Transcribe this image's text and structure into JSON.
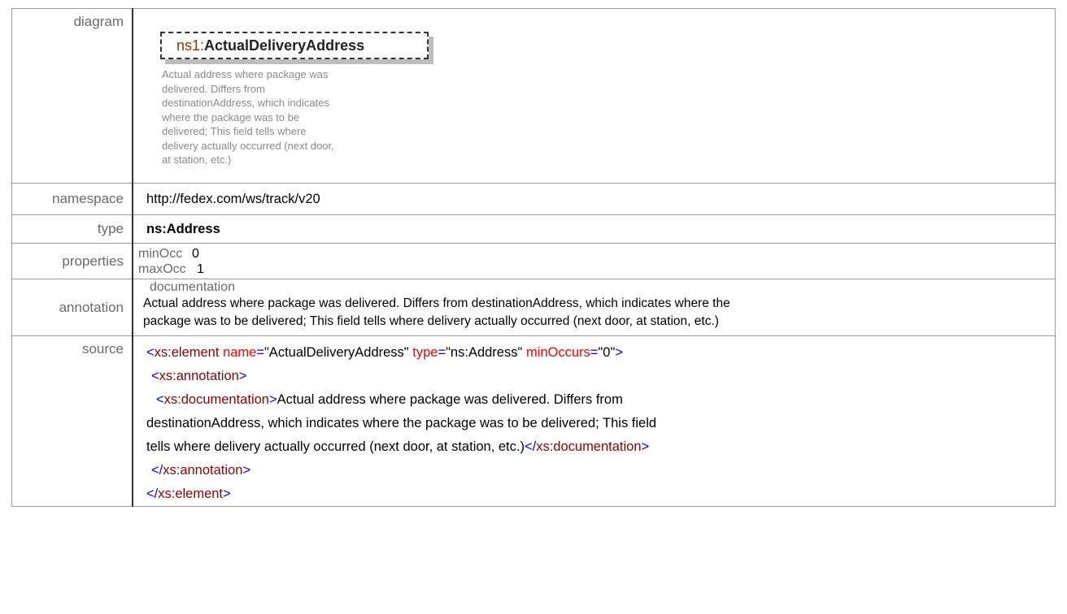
{
  "labels": {
    "diagram": "diagram",
    "namespace": "namespace",
    "type": "type",
    "properties": "properties",
    "annotation": "annotation",
    "source": "source"
  },
  "diagram": {
    "prefix": "ns1:",
    "name": "ActualDeliveryAddress",
    "doc_lines": [
      "Actual address where package was",
      "delivered. Differs from",
      "destinationAddress, which indicates",
      "where the package was to be",
      "delivered; This field tells where",
      "delivery actually occurred (next door,",
      "at station, etc.)"
    ]
  },
  "namespace": "http://fedex.com/ws/track/v20",
  "type": "ns:Address",
  "properties": {
    "min_label": "minOcc",
    "min_value": "0",
    "max_label": "maxOcc",
    "max_value": "1"
  },
  "annotation": {
    "heading": "documentation",
    "line1": "Actual address where package was delivered. Differs from destinationAddress, which indicates where the",
    "line2": "package was to be delivered; This field tells where delivery actually occurred (next door, at station, etc.)"
  },
  "source": {
    "lt": "<",
    "gt": ">",
    "lt_slash": "</",
    "eq": "=",
    "element_tag": "xs:element",
    "attr_name": "name",
    "val_name": "\"ActualDeliveryAddress\"",
    "attr_type": "type",
    "val_type": "\"ns:Address\"",
    "attr_min": "minOccurs",
    "val_min": "\"0\"",
    "annotation_tag": "xs:annotation",
    "documentation_tag": "xs:documentation",
    "doc_line1": "Actual address where package was delivered. Differs from",
    "doc_line2": "destinationAddress, which indicates where the package was to be delivered; This field",
    "doc_line3": "tells where delivery actually occurred (next door, at station, etc.)"
  },
  "colors": {
    "label_gray": "#6a6a6a",
    "source_tag": "#8b0000",
    "source_punct": "#0000ff",
    "source_attr": "#ff0000"
  }
}
